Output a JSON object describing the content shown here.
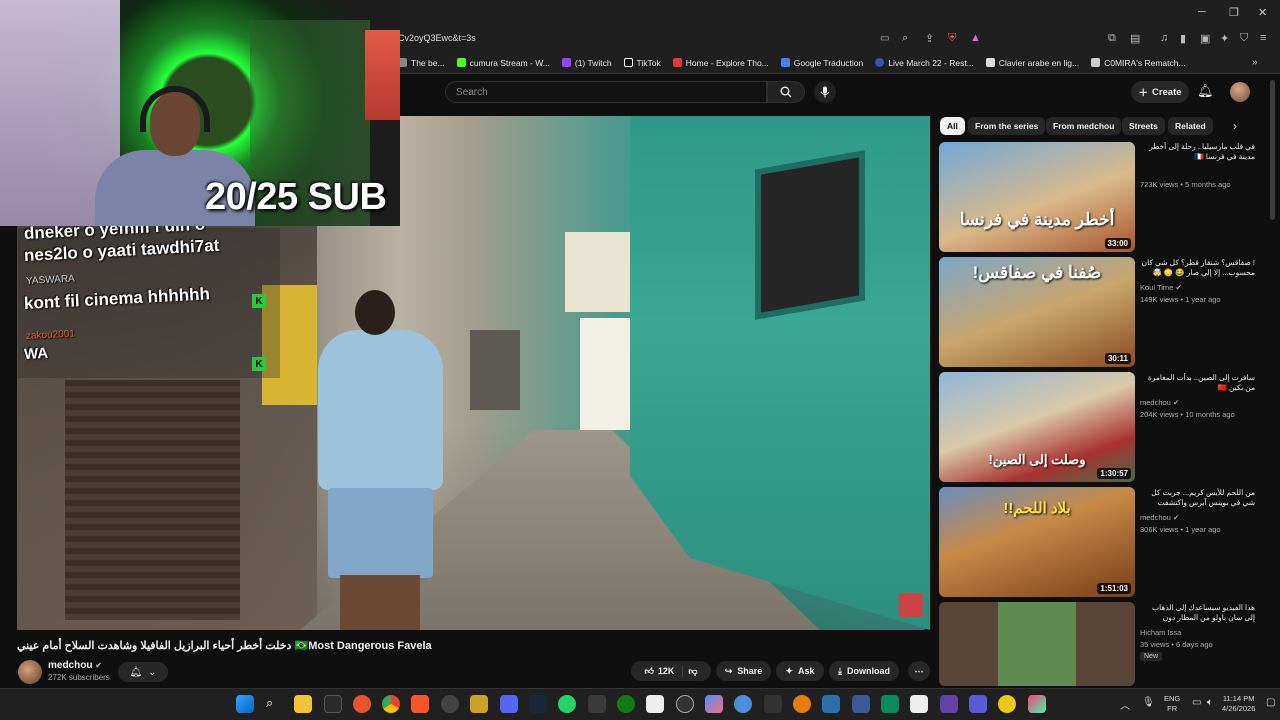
{
  "browser": {
    "url": "Cv2oyQ3Ewc&t=3s",
    "bookmarks": [
      {
        "label": "The be...",
        "color": "#888888"
      },
      {
        "label": "cumura Stream - W...",
        "color": "#53fc18"
      },
      {
        "label": "(1) Twitch",
        "color": "#9146ff"
      },
      {
        "label": "TikTok",
        "color": "#ffffff"
      },
      {
        "label": "Home - Explore Tho...",
        "color": "#e53935"
      },
      {
        "label": "Google Traduction",
        "color": "#4285f4"
      },
      {
        "label": "Live March 22 - Rest...",
        "color": "#3f51b5"
      },
      {
        "label": "Clavier arabe en lig...",
        "color": "#dddddd"
      },
      {
        "label": "C0MIRA's Rematch...",
        "color": "#cccccc"
      }
    ]
  },
  "youtube": {
    "search_placeholder": "Search",
    "create_label": "Create",
    "video": {
      "title": "دخلت أخطر أحياء البرازيل الفافيلا وشاهدت السلاح أمام عيني 🇧🇷Most Dangerous Favela",
      "channel": "medchou",
      "subscribers": "272K subscribers",
      "likes": "12K",
      "share_label": "Share",
      "ask_label": "Ask",
      "download_label": "Download"
    },
    "chips": [
      {
        "label": "All",
        "active": true
      },
      {
        "label": "From the series",
        "active": false
      },
      {
        "label": "From medchou",
        "active": false
      },
      {
        "label": "Streets",
        "active": false
      },
      {
        "label": "Related",
        "active": false
      }
    ],
    "related": [
      {
        "title": "في قلب مارسيليا.. رحلة إلى أخطر مدينة في فرنسا 🇫🇷",
        "channel": "",
        "meta": "723K views • 5 months ago",
        "duration": "33:00",
        "thumb_text": "أخطر مدينة في فرنسا",
        "badge": ""
      },
      {
        "title": "! صفاقس؟ شنقار قطر؟ كل شي كان محسوب... إلا إلي صار 😂 😳 🤯",
        "channel": "Koul Time",
        "meta": "149K views • 1 year ago",
        "duration": "30:11",
        "thumb_text": "صُفنا في صفاقس!",
        "badge": ""
      },
      {
        "title": "سافرت إلى الصين.. بدأت المغامرة من بكين 🇨🇳",
        "channel": "medchou",
        "meta": "204K views • 10 months ago",
        "duration": "1:30:57",
        "thumb_text": "وصلت إلى الصين!",
        "badge": ""
      },
      {
        "title": "من اللحم للأيس كريم... جربت كل شي في بوينس آيرس واكتشفت مدينة تعيش بالأكل 🇦🇷",
        "channel": "medchou",
        "meta": "306K views • 1 year ago",
        "duration": "1:51:03",
        "thumb_text": "بلاد اللحم!!",
        "badge": ""
      },
      {
        "title": "هذا الفيديو سيساعدك إلى الذهاب إلى سان باولو من المطار دون مساعدة أحد الحلقة",
        "channel": "Hicham Issa",
        "meta": "35 views • 6 days ago",
        "duration": "",
        "thumb_text": "",
        "badge": "New"
      }
    ]
  },
  "stream_overlay": {
    "sub_goal": "20/25 SUB",
    "chat": [
      {
        "name": "",
        "text": "dneker o yefhm f din o"
      },
      {
        "name": "",
        "text": "nes2lo o yaati tawdhi7at"
      },
      {
        "name": "YASWARA",
        "text": "kont fil cinema hhhhhh"
      },
      {
        "name": "zakou2001",
        "text": "WA"
      }
    ]
  },
  "taskbar": {
    "lang": "ENG",
    "lang_sub": "FR",
    "time": "11:14 PM",
    "date": "4/26/2026"
  }
}
